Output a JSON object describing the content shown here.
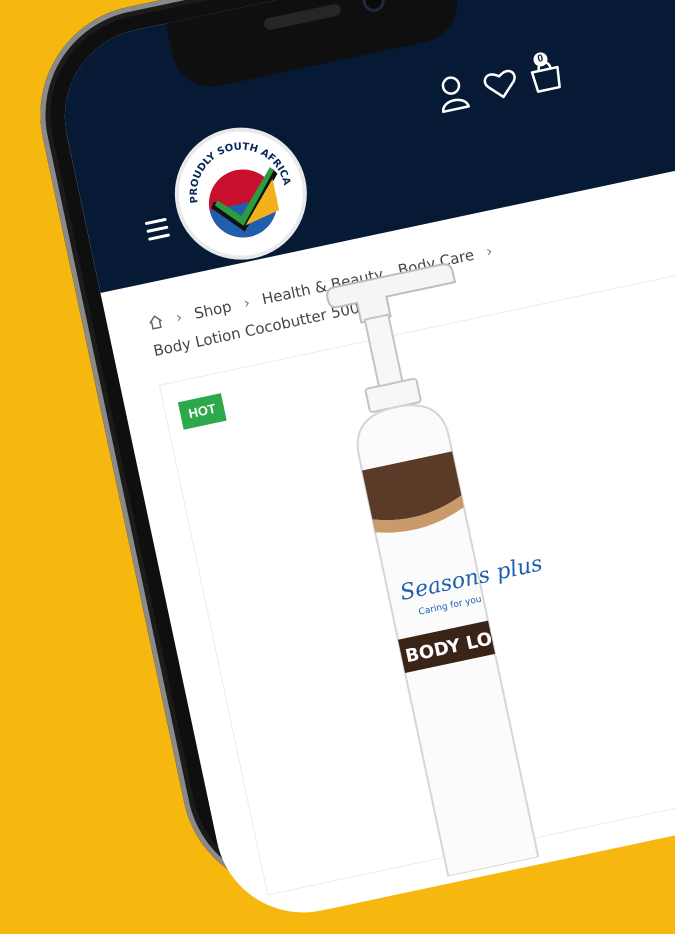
{
  "header": {
    "logo_text": "PROUDLY SOUTH AFRICAN",
    "cart_count": "0",
    "icons": [
      "menu-icon",
      "user-icon",
      "heart-icon",
      "cart-icon"
    ]
  },
  "breadcrumb": {
    "home_icon": "home-icon",
    "items": [
      "Shop",
      "Health & Beauty,",
      "Body Care"
    ],
    "current": "Body Lotion Cocobutter 500ml"
  },
  "product": {
    "badge": "HOT",
    "brand": "Seasons plus",
    "tagline": "Caring for you",
    "label": "BODY LOTION"
  },
  "colors": {
    "background": "#f6b70f",
    "header": "#061a36",
    "badge": "#2da84b",
    "bottle_cap_band": "#5b3b28"
  }
}
